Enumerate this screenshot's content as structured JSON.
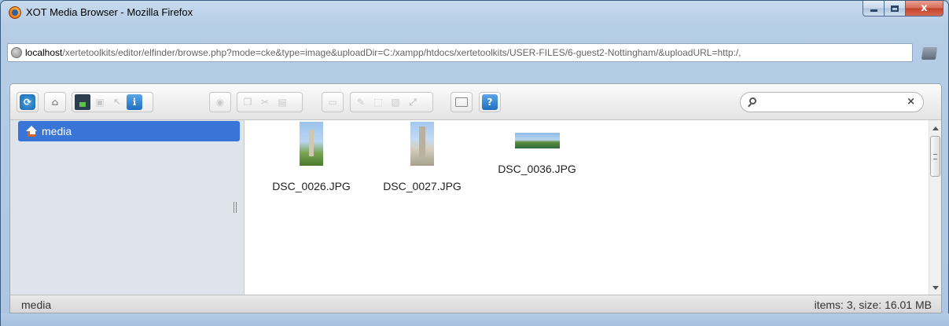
{
  "window": {
    "title": "XOT Media Browser - Mozilla Firefox",
    "close_glyph": "x"
  },
  "urlbar": {
    "host": "localhost",
    "path": "/xertetoolkits/editor/elfinder/browse.php?mode=cke&type=image&uploadDir=C:/xampp/htdocs/xertetoolkits/USER-FILES/6-guest2-Nottingham/&uploadURL=http:/,"
  },
  "toolbar": {
    "info_glyph": "i",
    "help_glyph": "?"
  },
  "search": {
    "value": "",
    "clear_glyph": "×"
  },
  "sidebar": {
    "items": [
      {
        "label": "media"
      }
    ]
  },
  "files": [
    {
      "name": "DSC_0026.JPG"
    },
    {
      "name": "DSC_0027.JPG"
    },
    {
      "name": "DSC_0036.JPG"
    }
  ],
  "status": {
    "path": "media",
    "info": "items: 3, size: 16.01 MB"
  }
}
